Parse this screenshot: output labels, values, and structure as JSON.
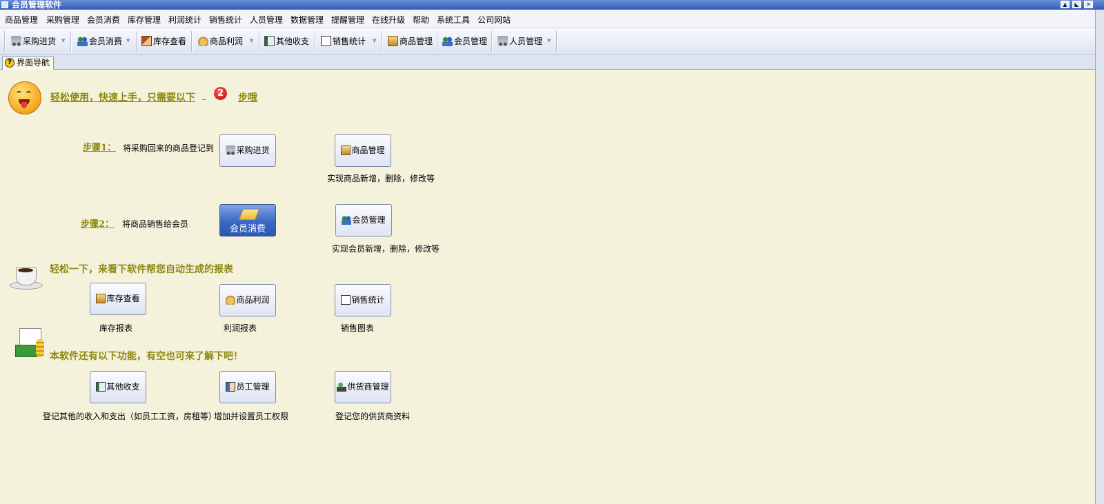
{
  "window": {
    "title": "会员管理软件"
  },
  "menu": [
    "商品管理",
    "采购管理",
    "会员消费",
    "库存管理",
    "利润统计",
    "销售统计",
    "人员管理",
    "数据管理",
    "提醒管理",
    "在线升级",
    "帮助",
    "系统工具",
    "公司网站"
  ],
  "toolbar": [
    "采购进货",
    "会员消费",
    "库存查看",
    "商品利润",
    "其他收支",
    "销售统计",
    "商品管理",
    "会员管理",
    "人员管理"
  ],
  "tab": {
    "label": "界面导航"
  },
  "intro": {
    "text_before": "轻松使用，快速上手，只需要以下",
    "step_count": "2",
    "text_after": "步哦"
  },
  "step1": {
    "label": "步骤1：",
    "text": "将采购回来的商品登记到",
    "button": "采购进货",
    "button2": "商品管理",
    "caption2": "实现商品新增，删除，修改等"
  },
  "step2": {
    "label": "步骤2：",
    "text": "将商品销售给会员",
    "button": "会员消费",
    "button2": "会员管理",
    "caption2": "实现会员新增，删除，修改等"
  },
  "reports": {
    "heading": "轻松一下，来看下软件帮您自动生成的报表",
    "buttons": [
      "库存查看",
      "商品利润",
      "销售统计"
    ],
    "captions": [
      "库存报表",
      "利润报表",
      "销售图表"
    ]
  },
  "more": {
    "heading": "本软件还有以下功能，有空也可来了解下吧！",
    "buttons": [
      "其他收支",
      "员工管理",
      "供货商管理"
    ],
    "captions": [
      "登记其他的收入和支出（如员工工资，房租等）",
      "增加并设置员工权限",
      "登记您的供货商资料"
    ]
  },
  "icons": {
    "cart": "cart-icon",
    "people": "people-icon",
    "house": "house-icon",
    "bag": "money-bag-icon",
    "book": "book-icon",
    "chart": "chart-icon",
    "box": "box-icon",
    "staff": "staff-icon",
    "supplier": "supplier-icon"
  },
  "colors": {
    "heading": "#8b8a10",
    "background": "#f5f2dc",
    "titlebar": "#2f5bb8"
  }
}
